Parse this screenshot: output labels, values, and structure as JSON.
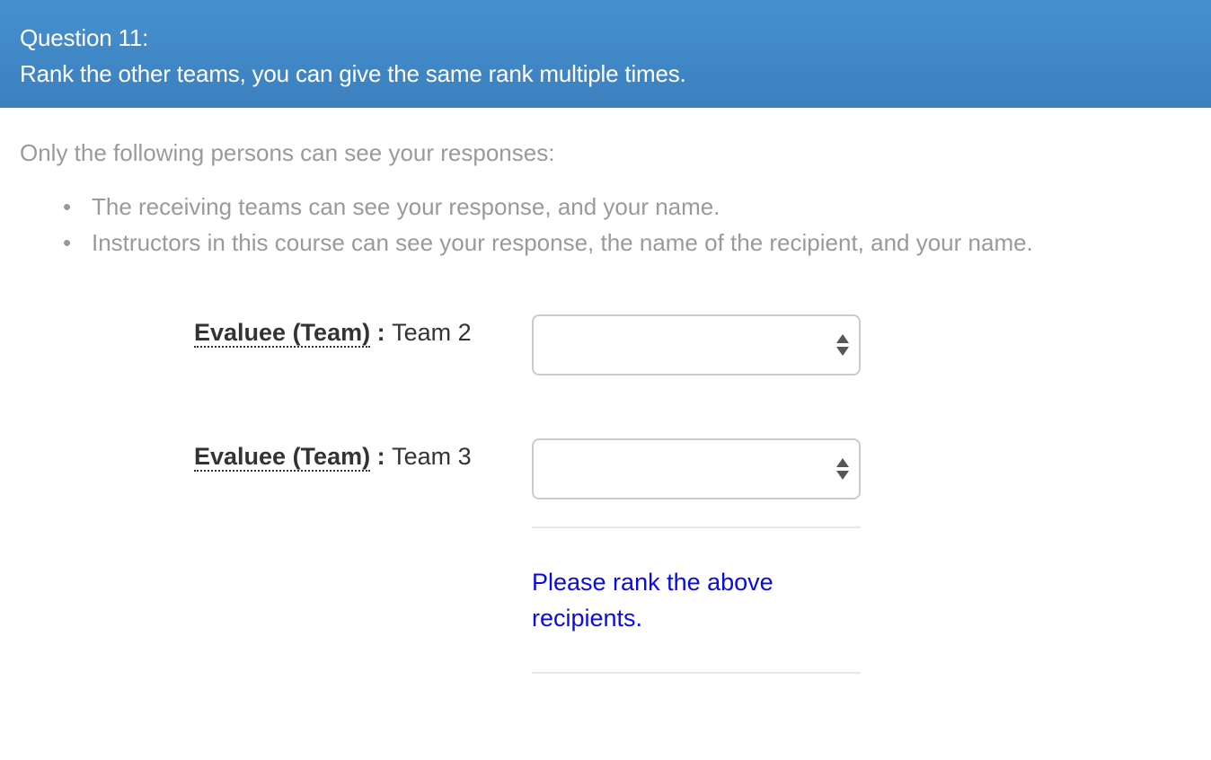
{
  "question": {
    "number_label": "Question 11:",
    "text": "Rank the other teams, you can give the same rank multiple times."
  },
  "visibility": {
    "intro": "Only the following persons can see your responses:",
    "items": [
      "The receiving teams can see your response, and your name.",
      "Instructors in this course can see your response, the name of the recipient, and your name."
    ]
  },
  "recipients": [
    {
      "role_label": "Evaluee (Team)",
      "separator": " : ",
      "name": "Team 2",
      "rank_value": ""
    },
    {
      "role_label": "Evaluee (Team)",
      "separator": " : ",
      "name": "Team 3",
      "rank_value": ""
    }
  ],
  "rank_message": "Please rank the above recipients.",
  "colors": {
    "header_bg": "#428bca",
    "muted_text": "#9a9a9a",
    "message_text": "#0a0ae6"
  }
}
